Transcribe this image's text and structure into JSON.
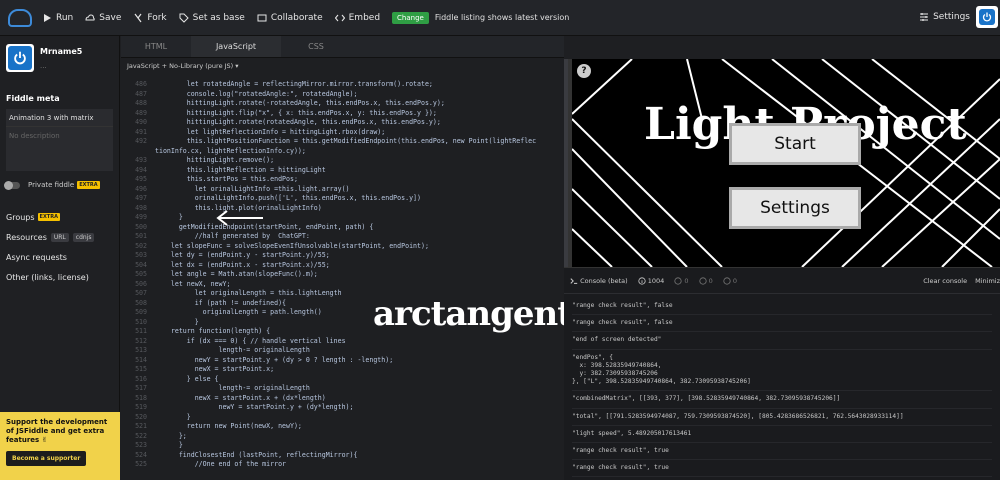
{
  "topbar": {
    "run": "Run",
    "save": "Save",
    "fork": "Fork",
    "set_base": "Set as base",
    "collaborate": "Collaborate",
    "embed": "Embed",
    "change_badge": "Change",
    "listing_note": "Fiddle listing shows latest version",
    "settings": "Settings"
  },
  "sidebar": {
    "user_name": "Mrname5",
    "user_sub": "...",
    "meta_heading": "Fiddle meta",
    "title_value": "Animation 3 with matrix",
    "description_placeholder": "No description",
    "private_label": "Private fiddle",
    "extra": "EXTRA",
    "groups": "Groups",
    "resources": "Resources",
    "res_tag_url": "URL",
    "res_tag_cdnjs": "cdnjs",
    "async": "Async requests",
    "other": "Other (links, license)",
    "promo_text": "Support the development of JSFiddle and get extra features ✌",
    "promo_button": "Become a supporter"
  },
  "editor": {
    "tabs": [
      "HTML",
      "JavaScript",
      "CSS"
    ],
    "lang": "JavaScript + No-Library (pure JS) ▾",
    "lines": [
      {
        "n": "486",
        "t": "        let rotatedAngle = reflectingMirror.mirror.transform().rotate;"
      },
      {
        "n": "487",
        "t": "        console.log(\"rotatedAngle:\", rotatedAngle);"
      },
      {
        "n": "488",
        "t": "        hittingLight.rotate(-rotatedAngle, this.endPos.x, this.endPos.y);"
      },
      {
        "n": "489",
        "t": "        hittingLight.flip(\"x\", { x: this.endPos.x, y: this.endPos.y });"
      },
      {
        "n": "490",
        "t": "        hittingLight.rotate(rotatedAngle, this.endPos.x, this.endPos.y);"
      },
      {
        "n": "491",
        "t": "        let lightReflectionInfo = hittingLight.rbox(draw);"
      },
      {
        "n": "492",
        "t": "        this.lightPositionFunction = this.getModifiedEndpoint(this.endPos, new Point(lightReflec"
      },
      {
        "n": "",
        "t": "tionInfo.cx, lightReflectionInfo.cy));"
      },
      {
        "n": "493",
        "t": "        hittingLight.remove();"
      },
      {
        "n": "494",
        "t": "        this.lightReflection = hittingLight"
      },
      {
        "n": "495",
        "t": "        this.startPos = this.endPos;"
      },
      {
        "n": "496",
        "t": "          let orinalLightInfo =this.light.array()"
      },
      {
        "n": "497",
        "t": "          orinalLightInfo.push(['L', this.endPos.x, this.endPos.y])"
      },
      {
        "n": "498",
        "t": "          this.light.plot(orinalLightInfo)"
      },
      {
        "n": "499",
        "t": "      }"
      },
      {
        "n": "500",
        "t": "      getModifiedEndpoint(startPoint, endPoint, path) {"
      },
      {
        "n": "501",
        "t": "          //half generated by  ChatGPT:"
      },
      {
        "n": "502",
        "t": "    let slopeFunc = solveSlopeEvenIfUnsolvable(startPoint, endPoint);"
      },
      {
        "n": "503",
        "t": "    let dy = (endPoint.y - startPoint.y)/55;"
      },
      {
        "n": "504",
        "t": "    let dx = (endPoint.x - startPoint.x)/55;"
      },
      {
        "n": "505",
        "t": "    let angle = Math.atan(slopeFunc().m);"
      },
      {
        "n": "506",
        "t": "    let newX, newY;"
      },
      {
        "n": "507",
        "t": "          let originalLength = this.lightLength"
      },
      {
        "n": "508",
        "t": "          if (path != undefined){"
      },
      {
        "n": "509",
        "t": "            originalLength = path.length()"
      },
      {
        "n": "510",
        "t": "          }"
      },
      {
        "n": "511",
        "t": "    return function(length) {"
      },
      {
        "n": "512",
        "t": "        if (dx === 0) { // handle vertical lines"
      },
      {
        "n": "513",
        "t": "                length-= originalLength"
      },
      {
        "n": "514",
        "t": "          newY = startPoint.y + (dy > 0 ? length : -length);"
      },
      {
        "n": "515",
        "t": "          newX = startPoint.x;"
      },
      {
        "n": "516",
        "t": "        } else {"
      },
      {
        "n": "517",
        "t": "                length-= originalLength"
      },
      {
        "n": "518",
        "t": "          newX = startPoint.x + (dx*length)"
      },
      {
        "n": "519",
        "t": "                newY = startPoint.y + (dy*length);"
      },
      {
        "n": "520",
        "t": "        }"
      },
      {
        "n": "521",
        "t": "        return new Point(newX, newY);"
      },
      {
        "n": "522",
        "t": "      };"
      },
      {
        "n": "523",
        "t": "      }"
      },
      {
        "n": "524",
        "t": "      findClosestEnd (lastPoint, reflectingMirror){"
      },
      {
        "n": "525",
        "t": "          //One end of the mirror"
      }
    ],
    "annotation": "arctangent"
  },
  "preview": {
    "help": "?",
    "title": "Light Project",
    "start": "Start",
    "settings": "Settings"
  },
  "console": {
    "title": "Console (beta)",
    "count": "1004",
    "c1": "0",
    "c2": "0",
    "c3": "0",
    "clear": "Clear console",
    "minimize": "Minimiz",
    "entries": [
      "\"range check result\", false",
      "\"range check result\", false",
      "\"end of screen detected\"",
      "\"endPos\", {\n  x: 398.52835949740864,\n  y: 382.73095938745206\n}, [\"L\", 398.52835949740864, 382.73095938745206]",
      "\"combinedMatrix\", [[393, 377], [398.52835949740864, 382.73095938745206]]",
      "\"total\", [[791.5283594974087, 759.7309593874520], [805.4283686526821, 762.5643028933114]]",
      "\"light speed\", 5.489205017613461",
      "\"range check result\", true",
      "\"range check result\", true"
    ],
    "prompt": ">"
  }
}
